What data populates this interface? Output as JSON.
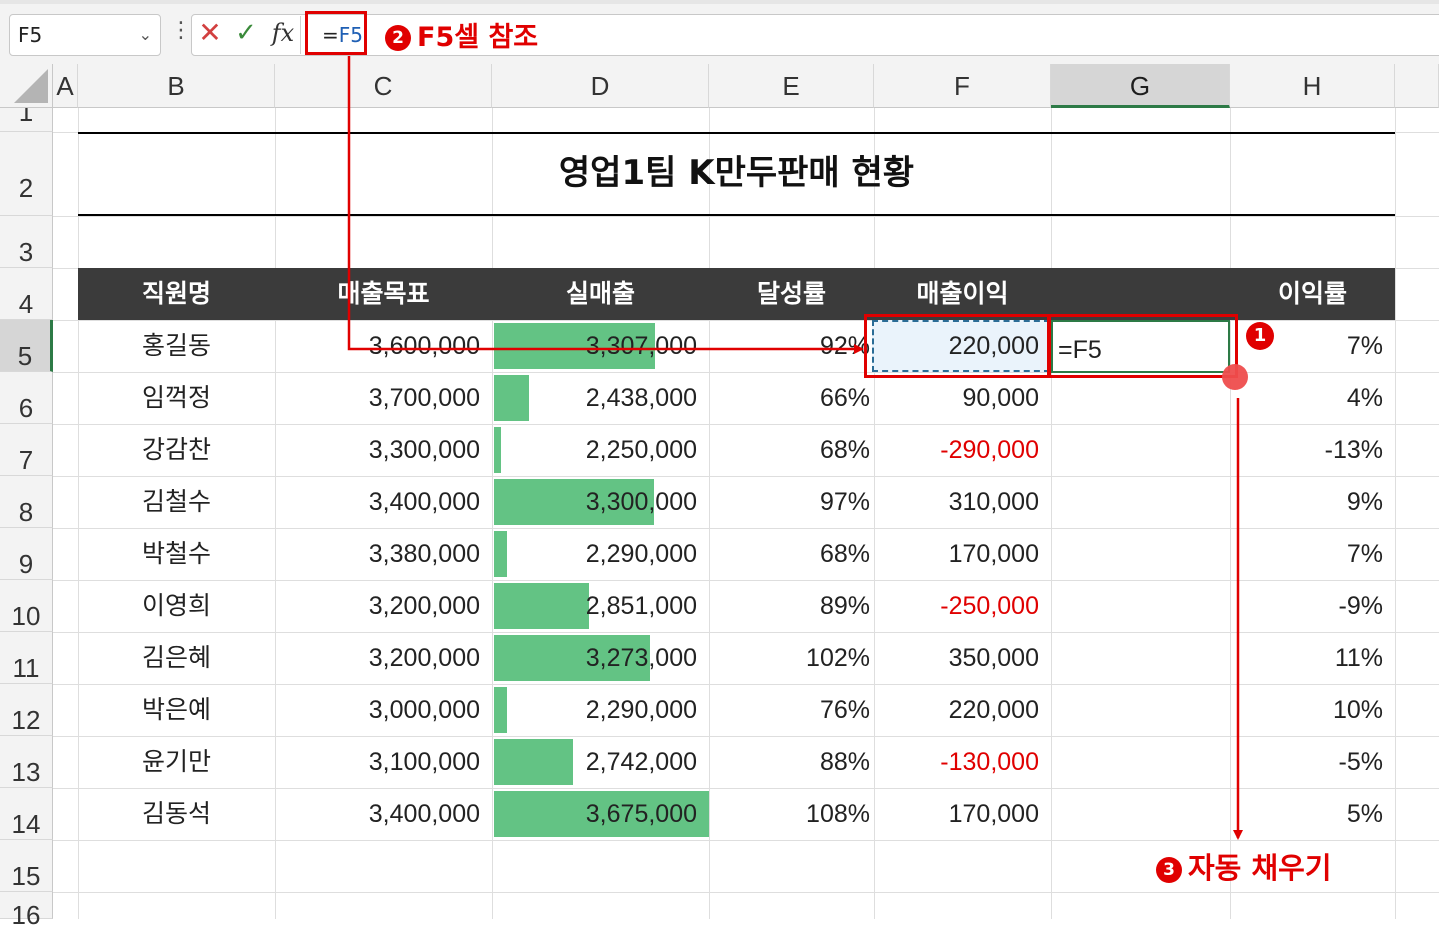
{
  "formula_bar": {
    "name_box": "F5",
    "formula_prefix": "=",
    "formula_ref": "F5"
  },
  "columns": [
    "A",
    "B",
    "C",
    "D",
    "E",
    "F",
    "G",
    "H"
  ],
  "selected_column": "G",
  "rows": [
    "1",
    "2",
    "3",
    "4",
    "5",
    "6",
    "7",
    "8",
    "9",
    "10",
    "11",
    "12",
    "13",
    "14",
    "15",
    "16"
  ],
  "selected_row": "5",
  "sheet": {
    "title": "영업1팀 K만두판매 현황",
    "headers": [
      "직원명",
      "매출목표",
      "실매출",
      "달성률",
      "매출이익",
      "",
      "이익률"
    ],
    "records": [
      {
        "name": "홍길동",
        "target": "3,600,000",
        "actual": "3,307,000",
        "actual_value": 3307000,
        "rate": "92%",
        "profit": "220,000",
        "profit_negative": false,
        "margin": "7%"
      },
      {
        "name": "임꺽정",
        "target": "3,700,000",
        "actual": "2,438,000",
        "actual_value": 2438000,
        "rate": "66%",
        "profit": "90,000",
        "profit_negative": false,
        "margin": "4%"
      },
      {
        "name": "강감찬",
        "target": "3,300,000",
        "actual": "2,250,000",
        "actual_value": 2250000,
        "rate": "68%",
        "profit": "-290,000",
        "profit_negative": true,
        "margin": "-13%"
      },
      {
        "name": "김철수",
        "target": "3,400,000",
        "actual": "3,300,000",
        "actual_value": 3300000,
        "rate": "97%",
        "profit": "310,000",
        "profit_negative": false,
        "margin": "9%"
      },
      {
        "name": "박철수",
        "target": "3,380,000",
        "actual": "2,290,000",
        "actual_value": 2290000,
        "rate": "68%",
        "profit": "170,000",
        "profit_negative": false,
        "margin": "7%"
      },
      {
        "name": "이영희",
        "target": "3,200,000",
        "actual": "2,851,000",
        "actual_value": 2851000,
        "rate": "89%",
        "profit": "-250,000",
        "profit_negative": true,
        "margin": "-9%"
      },
      {
        "name": "김은혜",
        "target": "3,200,000",
        "actual": "3,273,000",
        "actual_value": 3273000,
        "rate": "102%",
        "profit": "350,000",
        "profit_negative": false,
        "margin": "11%"
      },
      {
        "name": "박은예",
        "target": "3,000,000",
        "actual": "2,290,000",
        "actual_value": 2290000,
        "rate": "76%",
        "profit": "220,000",
        "profit_negative": false,
        "margin": "10%"
      },
      {
        "name": "윤기만",
        "target": "3,100,000",
        "actual": "2,742,000",
        "actual_value": 2742000,
        "rate": "88%",
        "profit": "-130,000",
        "profit_negative": true,
        "margin": "-5%"
      },
      {
        "name": "김동석",
        "target": "3,400,000",
        "actual": "3,675,000",
        "actual_value": 3675000,
        "rate": "108%",
        "profit": "170,000",
        "profit_negative": false,
        "margin": "5%"
      }
    ],
    "data_bar_range": [
      2200000,
      3675000
    ],
    "active_cell_edit": "=F5"
  },
  "annotations": {
    "step1": "1",
    "step2_num": "2",
    "step2_text": "F5셀 참조",
    "step3_num": "3",
    "step3_text": "자동 채우기"
  },
  "colors": {
    "accent_red": "#e00000",
    "header_band": "#3b3b3b",
    "data_bar": "#63c384",
    "negative": "#e00000",
    "selection_green": "#2d7a46"
  }
}
